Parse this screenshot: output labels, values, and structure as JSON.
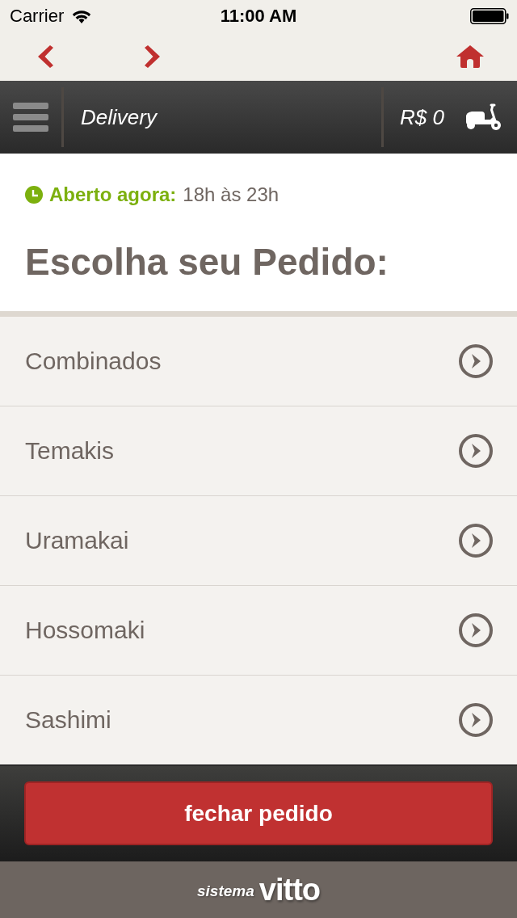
{
  "status_bar": {
    "carrier": "Carrier",
    "time": "11:00 AM"
  },
  "header": {
    "title": "Delivery",
    "cart_total": "R$ 0"
  },
  "hours": {
    "label": "Aberto agora:",
    "value": "18h às 23h"
  },
  "heading": "Escolha seu Pedido:",
  "categories": [
    {
      "label": "Combinados"
    },
    {
      "label": "Temakis"
    },
    {
      "label": "Uramakai"
    },
    {
      "label": "Hossomaki"
    },
    {
      "label": "Sashimi"
    }
  ],
  "checkout_button": "fechar pedido",
  "footer": {
    "brand_prefix": "sistema",
    "brand_name": "vitto"
  }
}
